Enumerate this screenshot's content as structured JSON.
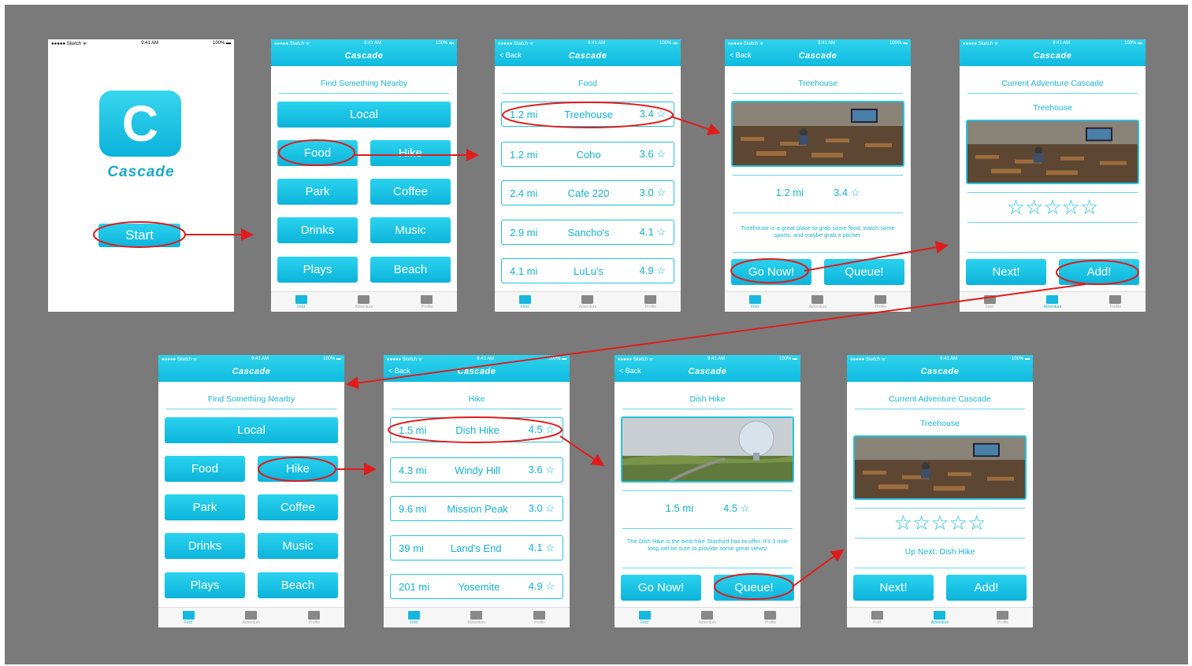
{
  "status_bar": {
    "carrier": "●●●●● Sketch ᯤ",
    "time": "9:41 AM",
    "battery": "100% ▬"
  },
  "app": {
    "name": "Cascade",
    "logo_letter": "C",
    "start_label": "Start",
    "back_label": "< Back"
  },
  "tabs": {
    "find": "Find",
    "adventure": "Adventure",
    "profile": "Profile"
  },
  "find": {
    "title": "Find Something Nearby",
    "local": "Local",
    "categories": [
      "Food",
      "Hike",
      "Park",
      "Coffee",
      "Drinks",
      "Music",
      "Plays",
      "Beach"
    ]
  },
  "food_list": {
    "title": "Food",
    "rows": [
      {
        "dist": "1.2 mi",
        "name": "Treehouse",
        "rating": "3.4 ☆"
      },
      {
        "dist": "1.2 mi",
        "name": "Coho",
        "rating": "3.6 ☆"
      },
      {
        "dist": "2.4 mi",
        "name": "Cafe 220",
        "rating": "3.0 ☆"
      },
      {
        "dist": "2.9 mi",
        "name": "Sancho's",
        "rating": "4.1 ☆"
      },
      {
        "dist": "4.1 mi",
        "name": "LuLu's",
        "rating": "4.9 ☆"
      }
    ]
  },
  "hike_list": {
    "title": "Hike",
    "rows": [
      {
        "dist": "1.5 mi",
        "name": "Dish Hike",
        "rating": "4.5 ☆"
      },
      {
        "dist": "4.3 mi",
        "name": "Windy Hill",
        "rating": "3.6 ☆"
      },
      {
        "dist": "9.6 mi",
        "name": "Mission Peak",
        "rating": "3.0 ☆"
      },
      {
        "dist": "39 mi",
        "name": "Land's End",
        "rating": "4.1 ☆"
      },
      {
        "dist": "201 mi",
        "name": "Yosemite",
        "rating": "4.9 ☆"
      }
    ]
  },
  "treehouse": {
    "title": "Treehouse",
    "dist": "1.2 mi",
    "rating": "3.4 ☆",
    "desc": "Treehouse is a great place to grab some food, watch some sports, and maybe grab a pitcher."
  },
  "dish": {
    "title": "Dish Hike",
    "dist": "1.5 mi",
    "rating": "4.5 ☆",
    "desc": "The Dish Hike is the best hike Stanford has to offer. It's 3 mile loop will be sure to provide some great views!"
  },
  "actions": {
    "go_now": "Go Now!",
    "queue": "Queue!",
    "next": "Next!",
    "add": "Add!"
  },
  "adventure": {
    "title": "Current Adventure Cascade",
    "place": "Treehouse",
    "stars": "☆☆☆☆☆",
    "up_next": "Up Next: Dish Hike"
  },
  "colors": {
    "accent": "#13b9dd",
    "annotation": "#e01b1b",
    "backdrop": "#7a7a7a"
  }
}
